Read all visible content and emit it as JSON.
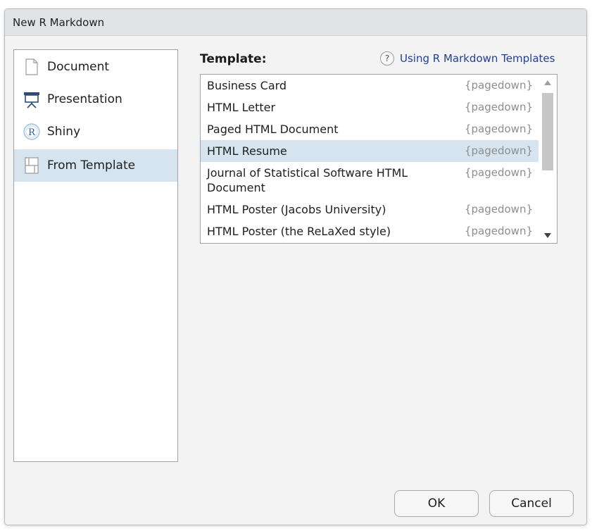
{
  "dialog": {
    "title": "New R Markdown"
  },
  "doc_types": [
    {
      "label": "Document",
      "icon": "document-icon",
      "selected": false
    },
    {
      "label": "Presentation",
      "icon": "presentation-icon",
      "selected": false
    },
    {
      "label": "Shiny",
      "icon": "shiny-r-icon",
      "selected": false
    },
    {
      "label": "From Template",
      "icon": "template-icon",
      "selected": true
    }
  ],
  "template_panel": {
    "heading": "Template:",
    "help_icon_text": "?",
    "help_link": "Using R Markdown Templates",
    "templates": [
      {
        "name": "Business Card",
        "package": "{pagedown}",
        "selected": false
      },
      {
        "name": "HTML Letter",
        "package": "{pagedown}",
        "selected": false
      },
      {
        "name": "Paged HTML Document",
        "package": "{pagedown}",
        "selected": false
      },
      {
        "name": "HTML Resume",
        "package": "{pagedown}",
        "selected": true
      },
      {
        "name": "Journal of Statistical Software HTML Document",
        "package": "{pagedown}",
        "selected": false
      },
      {
        "name": "HTML Poster (Jacobs University)",
        "package": "{pagedown}",
        "selected": false
      },
      {
        "name": "HTML Poster (the ReLaXed style)",
        "package": "{pagedown}",
        "selected": false
      }
    ]
  },
  "buttons": {
    "ok": "OK",
    "cancel": "Cancel"
  },
  "colors": {
    "selection": "#d6e4f0",
    "link": "#22409a",
    "package_text": "#8d8d8d"
  }
}
